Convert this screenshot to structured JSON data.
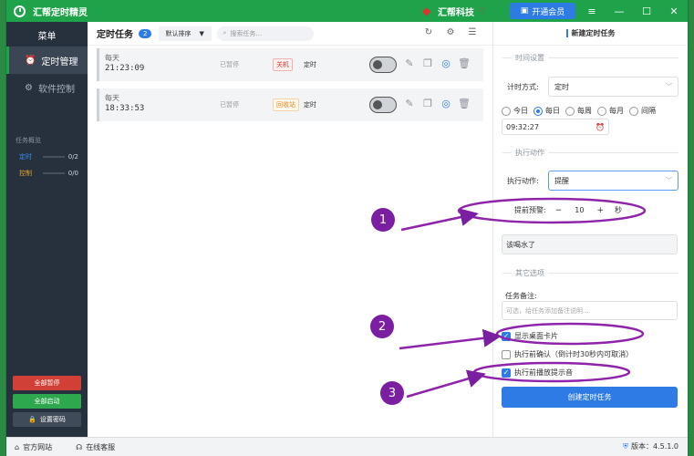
{
  "app": {
    "title": "汇帮定时精灵",
    "brand": "汇帮科技",
    "vip_label": "开通会员"
  },
  "window_controls": [
    "≡",
    "—",
    "☐",
    "✕"
  ],
  "sidebar": {
    "header": "菜单",
    "items": [
      {
        "label": "定时管理",
        "icon": "clock-icon"
      },
      {
        "label": "软件控制",
        "icon": "gear-icon"
      }
    ],
    "overview_title": "任务概览",
    "overview": [
      {
        "label": "定时",
        "count": "0/2"
      },
      {
        "label": "控制",
        "count": "0/0"
      }
    ],
    "buttons": {
      "pause_all": "全部暂停",
      "start_all": "全部启动",
      "set_password": "设置密码"
    }
  },
  "main": {
    "title": "定时任务",
    "count": "2",
    "sort_label": "默认排序",
    "search_placeholder": "搜索任务...",
    "tasks": [
      {
        "when": "每天",
        "time": "21:23:09",
        "status": "已暂停",
        "tag": "关机",
        "tag_color": "#e0302f",
        "mode": "定时"
      },
      {
        "when": "每天",
        "time": "18:33:53",
        "status": "已暂停",
        "tag": "回收站",
        "tag_color": "#e08a1f",
        "mode": "定时"
      }
    ]
  },
  "panel": {
    "title": "新建定时任务",
    "time_section": "时间设置",
    "timing_method_label": "计时方式:",
    "timing_method": "定时",
    "radios": [
      "今日",
      "每日",
      "每周",
      "每月",
      "间隔"
    ],
    "radio_selected": "每日",
    "time_value": "09:32:27",
    "action_section": "执行动作",
    "action_label": "执行动作:",
    "action_value": "提醒",
    "advance_label": "提前预警:",
    "advance_value": "10",
    "advance_unit": "秒",
    "message": "该喝水了",
    "other_section": "其它选项",
    "note_label": "任务备注:",
    "note_placeholder": "可选，给任务添加备注说明...",
    "options": [
      {
        "label": "显示桌面卡片",
        "checked": true
      },
      {
        "label": "执行前确认（倒计时30秒内可取消）",
        "checked": false
      },
      {
        "label": "执行前播放提示音",
        "checked": true
      }
    ],
    "create_label": "创建定时任务"
  },
  "statusbar": {
    "website": "官方网站",
    "support": "在线客服",
    "version": "版本：4.5.1.0"
  },
  "annotations": {
    "numbers": [
      "1",
      "2",
      "3"
    ],
    "color": "#7b1fa2"
  }
}
